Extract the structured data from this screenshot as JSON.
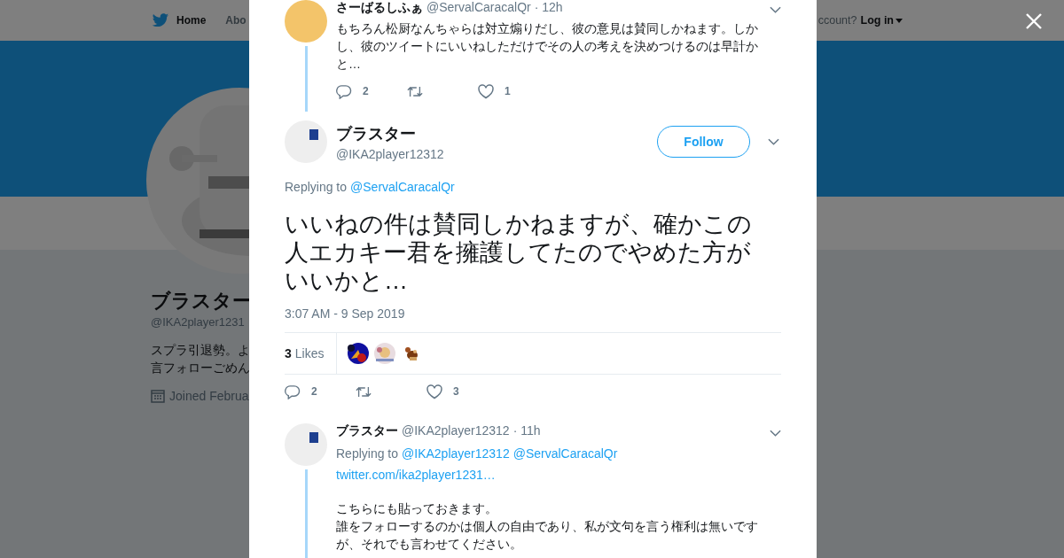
{
  "background": {
    "nav": [
      {
        "label": "Home",
        "selected": true
      },
      {
        "label": "Abo",
        "selected": false
      }
    ],
    "account_prompt": "ccount?",
    "login": "Log in",
    "profile": {
      "name": "ブラスター",
      "handle": "@IKA2player1231",
      "bio": [
        "スプラ引退勢。よ",
        "言フォローごめん"
      ],
      "joined": "Joined Februa"
    }
  },
  "modal": {
    "parent_tweet": {
      "name": "さーばるしふぁ",
      "handle": "@ServalCaracalQr",
      "time": "· 12h",
      "text": "もちろん松厨なんちゃらは対立煽りだし、彼の意見は賛同しかねます。しかし、彼のツイートにいいねしただけでその人の考えを決めつけるのは早計かと…",
      "replies": "2",
      "likes": "1"
    },
    "tweet": {
      "name": "ブラスター",
      "handle": "@IKA2player12312",
      "follow": "Follow",
      "replying_label": "Replying to",
      "replying_to": [
        "@ServalCaracalQr"
      ],
      "text": "いいねの件は賛同しかねますが、確かこの人エカキー君を擁護してたのでやめた方がいいかと…",
      "timestamp": "3:07 AM - 9 Sep 2019",
      "likes_count": "3",
      "likes_label": "Likes",
      "replies": "2",
      "likes": "3"
    },
    "reply": {
      "name": "ブラスター",
      "handle": "@IKA2player12312",
      "time": "· 11h",
      "replying_label": "Replying to",
      "replying_to": [
        "@IKA2player12312",
        "@ServalCaracalQr"
      ],
      "link": "twitter.com/ika2player1231…",
      "paragraphs": [
        "こちらにも貼っておきます。",
        "誰をフォローするのかは個人の自由であり、私が文句を言う権利は無いですが、それでも言わせてください。"
      ]
    }
  }
}
